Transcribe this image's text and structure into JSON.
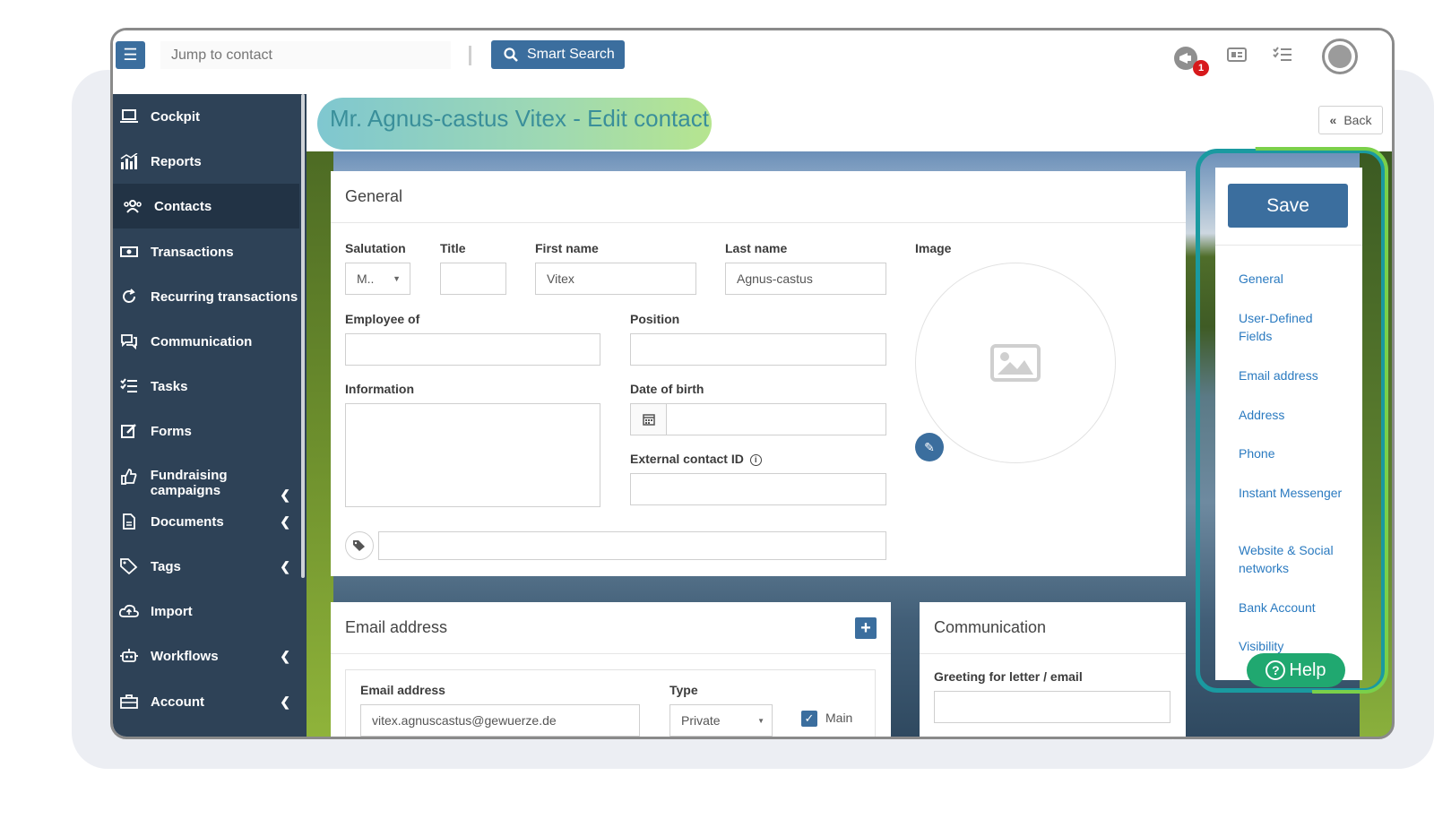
{
  "topbar": {
    "menu_icon": "hamburger-icon",
    "jump_placeholder": "Jump to contact",
    "smart_search_label": "Smart Search",
    "notification_count": "1"
  },
  "sidebar": {
    "items": [
      {
        "label": "Cockpit",
        "icon": "laptop-icon"
      },
      {
        "label": "Reports",
        "icon": "chart-icon"
      },
      {
        "label": "Contacts",
        "icon": "people-icon"
      },
      {
        "label": "Transactions",
        "icon": "money-icon"
      },
      {
        "label": "Recurring transactions",
        "icon": "refresh-icon"
      },
      {
        "label": "Communication",
        "icon": "chat-icon"
      },
      {
        "label": "Tasks",
        "icon": "checklist-icon"
      },
      {
        "label": "Forms",
        "icon": "edit-icon"
      },
      {
        "label": "Fundraising campaigns",
        "icon": "thumbs-up-icon"
      },
      {
        "label": "Documents",
        "icon": "document-icon"
      },
      {
        "label": "Tags",
        "icon": "tag-icon"
      },
      {
        "label": "Import",
        "icon": "cloud-upload-icon"
      },
      {
        "label": "Workflows",
        "icon": "robot-icon"
      },
      {
        "label": "Account",
        "icon": "briefcase-icon"
      }
    ]
  },
  "page": {
    "title": "Mr. Agnus-castus Vitex - Edit contact",
    "back_label": "Back"
  },
  "general": {
    "heading": "General",
    "salutation_label": "Salutation",
    "salutation_value": "M..",
    "title_label": "Title",
    "title_value": "",
    "first_name_label": "First name",
    "first_name_value": "Vitex",
    "last_name_label": "Last name",
    "last_name_value": "Agnus-castus",
    "image_label": "Image",
    "employee_label": "Employee of",
    "employee_value": "",
    "position_label": "Position",
    "position_value": "",
    "information_label": "Information",
    "information_value": "",
    "dob_label": "Date of birth",
    "dob_value": "",
    "external_id_label": "External contact ID",
    "external_id_value": ""
  },
  "email_section": {
    "heading": "Email address",
    "email_label": "Email address",
    "email_value": "vitex.agnuscastus@gewuerze.de",
    "type_label": "Type",
    "type_value": "Private",
    "main_label": "Main"
  },
  "communication_section": {
    "heading": "Communication",
    "greeting_label": "Greeting for letter / email",
    "greeting_value": ""
  },
  "right_panel": {
    "save_label": "Save",
    "links": [
      "General",
      "User-Defined Fields",
      "Email address",
      "Address",
      "Phone",
      "Instant Messenger",
      "Website & Social networks",
      "Bank Account",
      "Visibility"
    ],
    "help_label": "Help"
  },
  "colors": {
    "primary": "#3b6e9e",
    "sidebar": "#2e4257",
    "link": "#2a7ac0",
    "help": "#20a870",
    "highlight_teal": "#1a9aa0",
    "highlight_green": "#7ad04a"
  }
}
